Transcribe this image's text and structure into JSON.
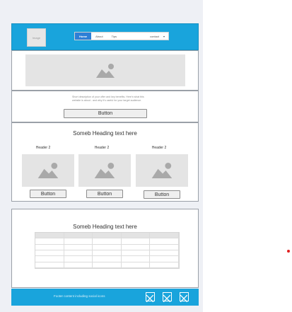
{
  "header": {
    "logo_label": "Image",
    "nav": {
      "items": [
        "Home",
        "About",
        "Tips"
      ],
      "active": "Home",
      "select_value": "contact",
      "select_caret": "▾"
    }
  },
  "offer": {
    "description": "Short description of your offer and key benefits. Here's what this website is about - and why it's useful for your target audience.",
    "button_label": "Button"
  },
  "features": {
    "heading": "Someb Heading text here",
    "columns": [
      {
        "header": "Header 2",
        "button_label": "Button"
      },
      {
        "header": "Header 2",
        "button_label": "Button"
      },
      {
        "header": "Header 2",
        "button_label": "Button"
      }
    ]
  },
  "table_section": {
    "heading": "Someb Heading text here"
  },
  "footer": {
    "text": "Footer content including social icons",
    "social_icons": [
      "social-icon-1",
      "social-icon-2",
      "social-icon-3"
    ]
  },
  "colors": {
    "header_bg": "#19a4dc",
    "nav_active": "#2e7fd6",
    "marker": "#e02020"
  }
}
